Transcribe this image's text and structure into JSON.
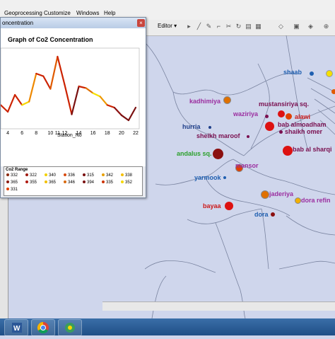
{
  "menu": {
    "items": [
      "Geoprocessing",
      "Customize",
      "Windows",
      "Help"
    ]
  },
  "toolbar": {
    "editor_label": "Editor ▾"
  },
  "graph_window": {
    "title": "oncentration",
    "close_symbol": "×"
  },
  "chart_data": {
    "type": "line",
    "title": "Graph of  Co2 Concentration",
    "xlabel": "Station_No",
    "ylabel": "",
    "x_ticks": [
      4,
      6,
      8,
      10,
      11,
      12,
      14,
      16,
      18,
      20,
      22
    ],
    "x": [
      3,
      4,
      5,
      6,
      7,
      8,
      9,
      10,
      11,
      12,
      13,
      14,
      15,
      16,
      17,
      18,
      19,
      20,
      21,
      22
    ],
    "y": [
      338,
      330,
      350,
      338,
      342,
      375,
      372,
      357,
      395,
      362,
      327,
      360,
      358,
      352,
      348,
      338,
      335,
      326,
      320,
      335
    ],
    "point_colors": [
      "#cc2200",
      "#cc2200",
      "#cc2200",
      "#f7d800",
      "#ee8800",
      "#cc2200",
      "#cc2200",
      "#e05a00",
      "#cc2200",
      "#cc2200",
      "#7a1010",
      "#cc2200",
      "#e07000",
      "#f5e000",
      "#ee9900",
      "#cc2200",
      "#8b1010",
      "#7a1010",
      "#7a1010",
      "#8b1010"
    ],
    "xlim": [
      3,
      22.5
    ],
    "ylim": [
      310,
      405
    ],
    "legend": {
      "title": "Co2 Range",
      "entries": [
        {
          "label": "332",
          "color": "#8b2a10"
        },
        {
          "label": "322",
          "color": "#a01a10"
        },
        {
          "label": "340",
          "color": "#f2d000"
        },
        {
          "label": "336",
          "color": "#d84a10"
        },
        {
          "label": "315",
          "color": "#7a1010"
        },
        {
          "label": "342",
          "color": "#e8a000"
        },
        {
          "label": "338",
          "color": "#f5c000"
        },
        {
          "label": "365",
          "color": "#8b1a10"
        },
        {
          "label": "355",
          "color": "#b01a10"
        },
        {
          "label": "365",
          "color": "#f2c000"
        },
        {
          "label": "346",
          "color": "#d86a10"
        },
        {
          "label": "394",
          "color": "#7a1010"
        },
        {
          "label": "335",
          "color": "#cc3300"
        },
        {
          "label": "352",
          "color": "#f5d800"
        },
        {
          "label": "331",
          "color": "#e04000"
        }
      ]
    }
  },
  "map": {
    "labels": [
      {
        "text": "shaab",
        "color": "#1f5fb0"
      },
      {
        "text": "kadhimiya",
        "color": "#9b2fa0"
      },
      {
        "text": "mustansiriya sq.",
        "color": "#7a1050"
      },
      {
        "text": "waziriya",
        "color": "#9b2fa0"
      },
      {
        "text": "alawi",
        "color": "#cc1a1a"
      },
      {
        "text": "hurria",
        "color": "#1f3f8a"
      },
      {
        "text": "bab almoadham",
        "color": "#7a1050"
      },
      {
        "text": "sheikh maroof",
        "color": "#7a1050"
      },
      {
        "text": "shaikh omer",
        "color": "#7a1050"
      },
      {
        "text": "andalus sq.",
        "color": "#2ca02c"
      },
      {
        "text": "bab al sharqi",
        "color": "#7a1050"
      },
      {
        "text": "mansor",
        "color": "#9b2fa0"
      },
      {
        "text": "yarmook",
        "color": "#1f5fb0"
      },
      {
        "text": "jaderiya",
        "color": "#9b2fa0"
      },
      {
        "text": "dora refin",
        "color": "#9b2fa0"
      },
      {
        "text": "bayaa",
        "color": "#cc1a1a"
      },
      {
        "text": "dora",
        "color": "#1f5fb0"
      }
    ]
  }
}
